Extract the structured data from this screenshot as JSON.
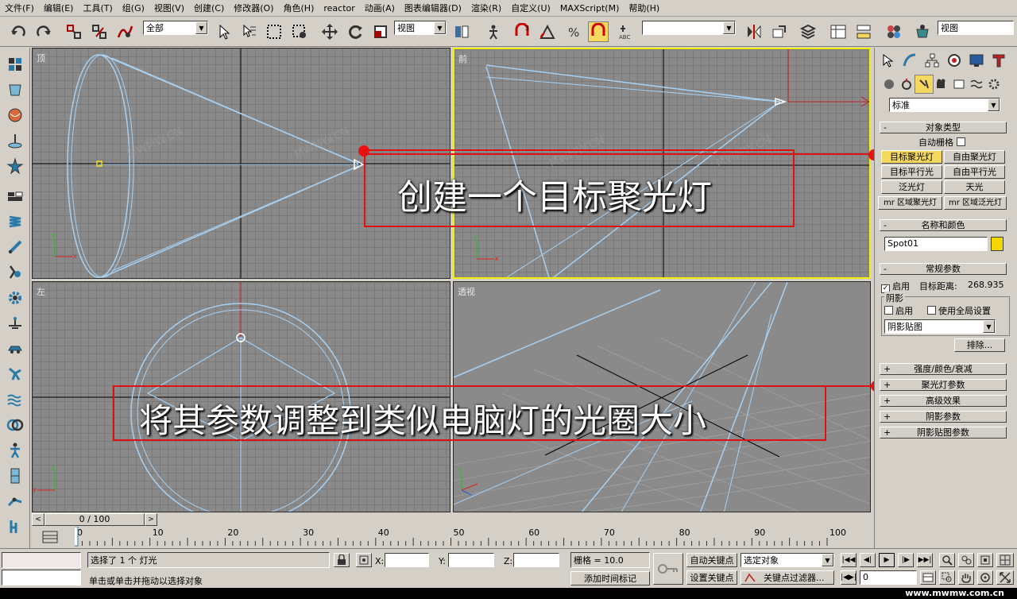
{
  "menu": [
    "文件(F)",
    "编辑(E)",
    "工具(T)",
    "组(G)",
    "视图(V)",
    "创建(C)",
    "修改器(O)",
    "角色(H)",
    "reactor",
    "动画(A)",
    "图表编辑器(D)",
    "渲染(R)",
    "自定义(U)",
    "MAXScript(M)",
    "帮助(H)"
  ],
  "toolbar": {
    "selection_filter": "全部",
    "ref_coord": "视图",
    "named_selection": "",
    "view_dropdown": "视图"
  },
  "viewports": {
    "top": "顶",
    "front": "前",
    "left": "左",
    "persp": "透视"
  },
  "watermark": "MWMW.CN",
  "annotations": {
    "create_spot": "创建一个目标聚光灯",
    "adjust_params": "将其参数调整到类似电脑灯的光圈大小"
  },
  "panel": {
    "category_dropdown": "标准",
    "object_type": {
      "title": "对象类型",
      "autogrid": "自动栅格",
      "buttons": [
        "目标聚光灯",
        "自由聚光灯",
        "目标平行光",
        "自由平行光",
        "泛光灯",
        "天光",
        "mr 区域聚光灯",
        "mr 区域泛光灯"
      ]
    },
    "name_color": {
      "title": "名称和颜色",
      "name": "Spot01",
      "color": "#f5d800"
    },
    "general": {
      "title": "常规参数",
      "on_label": "启用",
      "target_dist_label": "目标距离:",
      "target_dist": "268.935",
      "shadow_group": "阴影",
      "shadow_on": "启用",
      "use_global": "使用全局设置",
      "shadow_type": "阴影贴图",
      "exclude": "排除..."
    },
    "rollouts": [
      "强度/颜色/衰减",
      "聚光灯参数",
      "高级效果",
      "阴影参数",
      "阴影贴图参数"
    ]
  },
  "timeline": {
    "frame_display": "0 / 100",
    "ticks": [
      "0",
      "10",
      "20",
      "30",
      "40",
      "50",
      "60",
      "70",
      "80",
      "90",
      "100"
    ]
  },
  "status": {
    "selected": "选择了 1 个 灯光",
    "prompt": "单击或单击并拖动以选择对象",
    "x_label": "X:",
    "y_label": "Y:",
    "z_label": "Z:",
    "grid": "栅格 = 10.0",
    "add_time_tag": "添加时间标记",
    "auto_key": "自动关键点",
    "set_key": "设置关键点",
    "selected_obj": "选定对象",
    "key_filters": "关键点过滤器...",
    "frame": "0"
  },
  "footer_url": "www.mwmw.com.cn"
}
